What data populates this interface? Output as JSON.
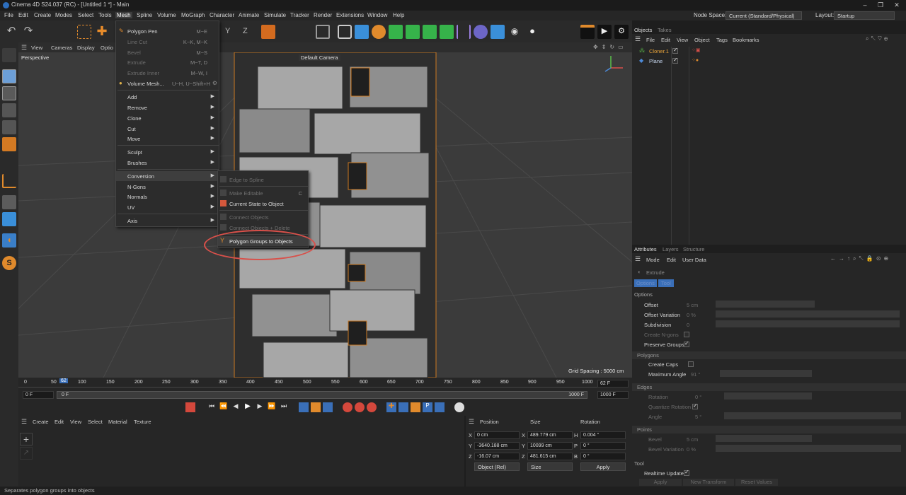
{
  "window": {
    "title": "Cinema 4D S24.037 (RC) - [Untitled 1 *] - Main",
    "controls": [
      "–",
      "❐",
      "✕"
    ]
  },
  "menubar": {
    "items": [
      "File",
      "Edit",
      "Create",
      "Modes",
      "Select",
      "Tools",
      "Mesh",
      "Spline",
      "Volume",
      "MoGraph",
      "Character",
      "Animate",
      "Simulate",
      "Tracker",
      "Render",
      "Extensions",
      "Window",
      "Help"
    ],
    "node_space_label": "Node Space:",
    "node_space_value": "Current (Standard/Physical)",
    "layout_label": "Layout:",
    "layout_value": "Startup"
  },
  "viewport": {
    "menu": [
      "View",
      "Cameras",
      "Display",
      "Optio"
    ],
    "name": "Perspective",
    "camera": "Default Camera",
    "grid_spacing": "Grid Spacing : 5000 cm"
  },
  "timeline": {
    "ticks": [
      "0",
      "50",
      "100",
      "150",
      "200",
      "250",
      "300",
      "350",
      "400",
      "450",
      "500",
      "550",
      "600",
      "650",
      "700",
      "750",
      "800",
      "850",
      "900",
      "950",
      "1000"
    ],
    "current_frame_marker": "62",
    "current_frame": "62 F",
    "start_field": "0 F",
    "start_field_2": "0 F",
    "end_field": "1000 F",
    "end_field_2": "1000 F"
  },
  "material_manager": {
    "menu": [
      "Create",
      "Edit",
      "View",
      "Select",
      "Material",
      "Texture"
    ]
  },
  "coordinates": {
    "headers": [
      "Position",
      "Size",
      "Rotation"
    ],
    "rows": [
      {
        "axis": "X",
        "pos": "0 cm",
        "size_axis": "X",
        "size": "489.779 cm",
        "rot_axis": "H",
        "rot": "0.004 °"
      },
      {
        "axis": "Y",
        "pos": "-3640.188 cm",
        "size_axis": "Y",
        "size": "10099 cm",
        "rot_axis": "P",
        "rot": "0 °"
      },
      {
        "axis": "Z",
        "pos": "-16.07 cm",
        "size_axis": "Z",
        "size": "481.615 cm",
        "rot_axis": "B",
        "rot": "0 °"
      }
    ],
    "mode": "Object (Rel)",
    "size_mode": "Size",
    "apply": "Apply"
  },
  "objects_panel": {
    "tabs": [
      "Objects",
      "Takes"
    ],
    "menu": [
      "File",
      "Edit",
      "View",
      "Object",
      "Tags",
      "Bookmarks"
    ],
    "items": [
      {
        "name": "Cloner.1",
        "color": "#e8a33a"
      },
      {
        "name": "Plane",
        "color": "#9ac3ef"
      }
    ]
  },
  "attributes_panel": {
    "tabs": [
      "Attributes",
      "Layers",
      "Structure"
    ],
    "menu": [
      "Mode",
      "Edit",
      "User Data"
    ],
    "tool_name": "Extrude",
    "subtabs": [
      "Options",
      "Tool"
    ],
    "options_header": "Options",
    "options": [
      {
        "label": "Offset",
        "value": "5 cm",
        "type": "slider",
        "enabled": true
      },
      {
        "label": "Offset Variation",
        "value": "0 %",
        "type": "slider",
        "enabled": true
      },
      {
        "label": "Subdivision",
        "value": "0",
        "type": "slider",
        "enabled": true
      },
      {
        "label": "Create N-gons",
        "type": "check",
        "checked": false,
        "enabled": false
      },
      {
        "label": "Preserve Groups",
        "type": "check",
        "checked": true,
        "enabled": true
      }
    ],
    "polygons_header": "Polygons",
    "polygons": [
      {
        "label": "Create Caps",
        "type": "check",
        "checked": false,
        "enabled": true
      },
      {
        "label": "Maximum Angle",
        "value": "91 °",
        "type": "slider",
        "enabled": true
      }
    ],
    "edges_header": "Edges",
    "edges": [
      {
        "label": "Rotation",
        "value": "0 °",
        "type": "slider",
        "enabled": false
      },
      {
        "label": "Quantize Rotation",
        "type": "check",
        "checked": true,
        "enabled": false
      },
      {
        "label": "Angle",
        "value": "5 °",
        "type": "slider",
        "enabled": false
      }
    ],
    "points_header": "Points",
    "points": [
      {
        "label": "Bevel",
        "value": "5 cm",
        "type": "slider",
        "enabled": false
      },
      {
        "label": "Bevel Variation",
        "value": "0 %",
        "type": "slider",
        "enabled": false
      }
    ],
    "tool_header": "Tool",
    "realtime_label": "Realtime Update",
    "buttons": [
      "Apply",
      "New Transform",
      "Reset Values"
    ]
  },
  "mesh_menu": {
    "items": [
      {
        "label": "Polygon Pen",
        "shortcut": "M~E",
        "enabled": true,
        "submenu": false
      },
      {
        "label": "Line Cut",
        "shortcut": "K~K, M~K",
        "enabled": false,
        "submenu": false
      },
      {
        "label": "Bevel",
        "shortcut": "M~S",
        "enabled": false,
        "submenu": false
      },
      {
        "label": "Extrude",
        "shortcut": "M~T, D",
        "enabled": false,
        "submenu": false
      },
      {
        "label": "Extrude Inner",
        "shortcut": "M~W, I",
        "enabled": false,
        "submenu": false
      },
      {
        "label": "Volume Mesh...",
        "shortcut": "U~H, U~Shift+H",
        "enabled": true,
        "submenu": false
      },
      {
        "label": "Add",
        "shortcut": "",
        "enabled": true,
        "submenu": true
      },
      {
        "label": "Remove",
        "shortcut": "",
        "enabled": true,
        "submenu": true
      },
      {
        "label": "Clone",
        "shortcut": "",
        "enabled": true,
        "submenu": true
      },
      {
        "label": "Cut",
        "shortcut": "",
        "enabled": true,
        "submenu": true
      },
      {
        "label": "Move",
        "shortcut": "",
        "enabled": true,
        "submenu": true
      },
      {
        "label": "Sculpt",
        "shortcut": "",
        "enabled": true,
        "submenu": true
      },
      {
        "label": "Brushes",
        "shortcut": "",
        "enabled": true,
        "submenu": true
      },
      {
        "label": "Conversion",
        "shortcut": "",
        "enabled": true,
        "submenu": true
      },
      {
        "label": "N-Gons",
        "shortcut": "",
        "enabled": true,
        "submenu": true
      },
      {
        "label": "Normals",
        "shortcut": "",
        "enabled": true,
        "submenu": true
      },
      {
        "label": "UV",
        "shortcut": "",
        "enabled": true,
        "submenu": true
      },
      {
        "label": "Axis",
        "shortcut": "",
        "enabled": true,
        "submenu": true
      }
    ]
  },
  "conversion_menu": {
    "items": [
      {
        "label": "Edge to Spline",
        "shortcut": "",
        "enabled": false
      },
      {
        "label": "Make Editable",
        "shortcut": "C",
        "enabled": false
      },
      {
        "label": "Current State to Object",
        "shortcut": "",
        "enabled": true
      },
      {
        "label": "Connect Objects",
        "shortcut": "",
        "enabled": false
      },
      {
        "label": "Connect Objects + Delete",
        "shortcut": "",
        "enabled": false
      },
      {
        "label": "Polygon Groups to Objects",
        "shortcut": "",
        "enabled": true
      }
    ]
  },
  "status": {
    "text": "Separates polygon groups into objects"
  }
}
